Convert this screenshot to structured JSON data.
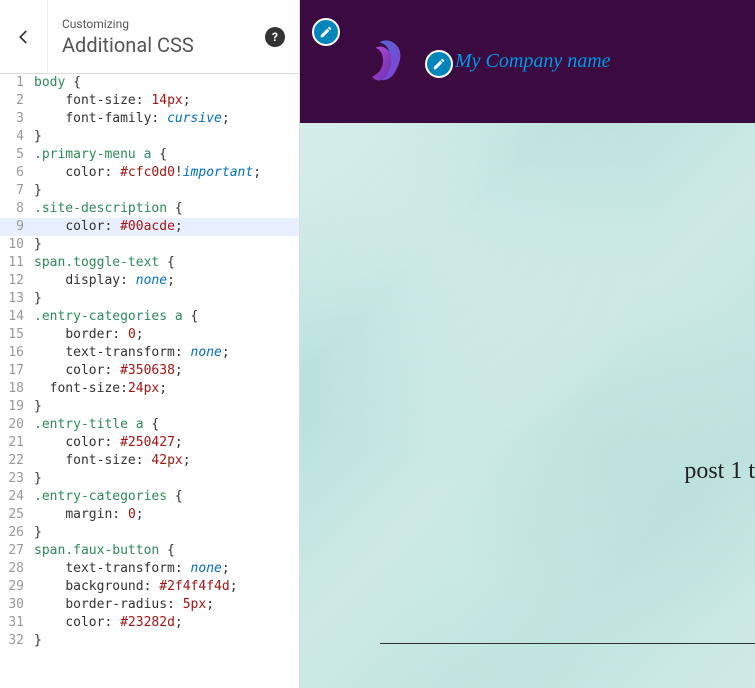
{
  "header": {
    "crumb": "Customizing",
    "title": "Additional CSS",
    "help": "?"
  },
  "code_lines": [
    {
      "n": 1,
      "hl": false,
      "tokens": [
        [
          "sel",
          "body"
        ],
        [
          "punc",
          " {"
        ]
      ]
    },
    {
      "n": 2,
      "hl": false,
      "tokens": [
        [
          "punc",
          "    "
        ],
        [
          "prop",
          "font-size"
        ],
        [
          "punc",
          ": "
        ],
        [
          "num",
          "14px"
        ],
        [
          "punc",
          ";"
        ]
      ]
    },
    {
      "n": 3,
      "hl": false,
      "tokens": [
        [
          "punc",
          "    "
        ],
        [
          "prop",
          "font-family"
        ],
        [
          "punc",
          ": "
        ],
        [
          "kw",
          "cursive"
        ],
        [
          "punc",
          ";"
        ]
      ]
    },
    {
      "n": 4,
      "hl": false,
      "tokens": [
        [
          "punc",
          "}"
        ]
      ]
    },
    {
      "n": 5,
      "hl": false,
      "tokens": [
        [
          "cls",
          ".primary-menu"
        ],
        [
          "punc",
          " "
        ],
        [
          "tag",
          "a"
        ],
        [
          "punc",
          " {"
        ]
      ]
    },
    {
      "n": 6,
      "hl": false,
      "tokens": [
        [
          "punc",
          "    "
        ],
        [
          "prop",
          "color"
        ],
        [
          "punc",
          ": "
        ],
        [
          "val",
          "#cfc0d0"
        ],
        [
          "punc",
          "!"
        ],
        [
          "kw",
          "important"
        ],
        [
          "punc",
          ";"
        ]
      ]
    },
    {
      "n": 7,
      "hl": false,
      "tokens": [
        [
          "punc",
          "}"
        ]
      ]
    },
    {
      "n": 8,
      "hl": false,
      "tokens": [
        [
          "cls",
          ".site-description"
        ],
        [
          "punc",
          " {"
        ]
      ]
    },
    {
      "n": 9,
      "hl": true,
      "tokens": [
        [
          "punc",
          "    "
        ],
        [
          "prop",
          "color"
        ],
        [
          "punc",
          ": "
        ],
        [
          "val",
          "#00acde"
        ],
        [
          "punc",
          ";"
        ]
      ]
    },
    {
      "n": 10,
      "hl": false,
      "tokens": [
        [
          "punc",
          "}"
        ]
      ]
    },
    {
      "n": 11,
      "hl": false,
      "tokens": [
        [
          "tag",
          "span"
        ],
        [
          "cls",
          ".toggle-text"
        ],
        [
          "punc",
          " {"
        ]
      ]
    },
    {
      "n": 12,
      "hl": false,
      "tokens": [
        [
          "punc",
          "    "
        ],
        [
          "prop",
          "display"
        ],
        [
          "punc",
          ": "
        ],
        [
          "kw",
          "none"
        ],
        [
          "punc",
          ";"
        ]
      ]
    },
    {
      "n": 13,
      "hl": false,
      "tokens": [
        [
          "punc",
          "}"
        ]
      ]
    },
    {
      "n": 14,
      "hl": false,
      "tokens": [
        [
          "cls",
          ".entry-categories"
        ],
        [
          "punc",
          " "
        ],
        [
          "tag",
          "a"
        ],
        [
          "punc",
          " {"
        ]
      ]
    },
    {
      "n": 15,
      "hl": false,
      "tokens": [
        [
          "punc",
          "    "
        ],
        [
          "prop",
          "border"
        ],
        [
          "punc",
          ": "
        ],
        [
          "num",
          "0"
        ],
        [
          "punc",
          ";"
        ]
      ]
    },
    {
      "n": 16,
      "hl": false,
      "tokens": [
        [
          "punc",
          "    "
        ],
        [
          "prop",
          "text-transform"
        ],
        [
          "punc",
          ": "
        ],
        [
          "kw",
          "none"
        ],
        [
          "punc",
          ";"
        ]
      ]
    },
    {
      "n": 17,
      "hl": false,
      "tokens": [
        [
          "punc",
          "    "
        ],
        [
          "prop",
          "color"
        ],
        [
          "punc",
          ": "
        ],
        [
          "val",
          "#350638"
        ],
        [
          "punc",
          ";"
        ]
      ]
    },
    {
      "n": 18,
      "hl": false,
      "tokens": [
        [
          "punc",
          "  "
        ],
        [
          "prop",
          "font-size"
        ],
        [
          "punc",
          ":"
        ],
        [
          "num",
          "24px"
        ],
        [
          "punc",
          ";"
        ]
      ]
    },
    {
      "n": 19,
      "hl": false,
      "tokens": [
        [
          "punc",
          "}"
        ]
      ]
    },
    {
      "n": 20,
      "hl": false,
      "tokens": [
        [
          "cls",
          ".entry-title"
        ],
        [
          "punc",
          " "
        ],
        [
          "tag",
          "a"
        ],
        [
          "punc",
          " {"
        ]
      ]
    },
    {
      "n": 21,
      "hl": false,
      "tokens": [
        [
          "punc",
          "    "
        ],
        [
          "prop",
          "color"
        ],
        [
          "punc",
          ": "
        ],
        [
          "val",
          "#250427"
        ],
        [
          "punc",
          ";"
        ]
      ]
    },
    {
      "n": 22,
      "hl": false,
      "tokens": [
        [
          "punc",
          "    "
        ],
        [
          "prop",
          "font-size"
        ],
        [
          "punc",
          ": "
        ],
        [
          "num",
          "42px"
        ],
        [
          "punc",
          ";"
        ]
      ]
    },
    {
      "n": 23,
      "hl": false,
      "tokens": [
        [
          "punc",
          "}"
        ]
      ]
    },
    {
      "n": 24,
      "hl": false,
      "tokens": [
        [
          "cls",
          ".entry-categories"
        ],
        [
          "punc",
          " {"
        ]
      ]
    },
    {
      "n": 25,
      "hl": false,
      "tokens": [
        [
          "punc",
          "    "
        ],
        [
          "prop",
          "margin"
        ],
        [
          "punc",
          ": "
        ],
        [
          "num",
          "0"
        ],
        [
          "punc",
          ";"
        ]
      ]
    },
    {
      "n": 26,
      "hl": false,
      "tokens": [
        [
          "punc",
          "}"
        ]
      ]
    },
    {
      "n": 27,
      "hl": false,
      "tokens": [
        [
          "tag",
          "span"
        ],
        [
          "cls",
          ".faux-button"
        ],
        [
          "punc",
          " {"
        ]
      ]
    },
    {
      "n": 28,
      "hl": false,
      "tokens": [
        [
          "punc",
          "    "
        ],
        [
          "prop",
          "text-transform"
        ],
        [
          "punc",
          ": "
        ],
        [
          "kw",
          "none"
        ],
        [
          "punc",
          ";"
        ]
      ]
    },
    {
      "n": 29,
      "hl": false,
      "tokens": [
        [
          "punc",
          "    "
        ],
        [
          "prop",
          "background"
        ],
        [
          "punc",
          ": "
        ],
        [
          "val",
          "#2f4f4f4d"
        ],
        [
          "punc",
          ";"
        ]
      ]
    },
    {
      "n": 30,
      "hl": false,
      "tokens": [
        [
          "punc",
          "    "
        ],
        [
          "prop",
          "border-radius"
        ],
        [
          "punc",
          ": "
        ],
        [
          "num",
          "5px"
        ],
        [
          "punc",
          ";"
        ]
      ]
    },
    {
      "n": 31,
      "hl": false,
      "tokens": [
        [
          "punc",
          "    "
        ],
        [
          "prop",
          "color"
        ],
        [
          "punc",
          ": "
        ],
        [
          "val",
          "#23282d"
        ],
        [
          "punc",
          ";"
        ]
      ]
    },
    {
      "n": 32,
      "hl": false,
      "tokens": [
        [
          "punc",
          "}"
        ]
      ]
    }
  ],
  "preview": {
    "company": "My Company name",
    "post_title": "post 1 t"
  }
}
